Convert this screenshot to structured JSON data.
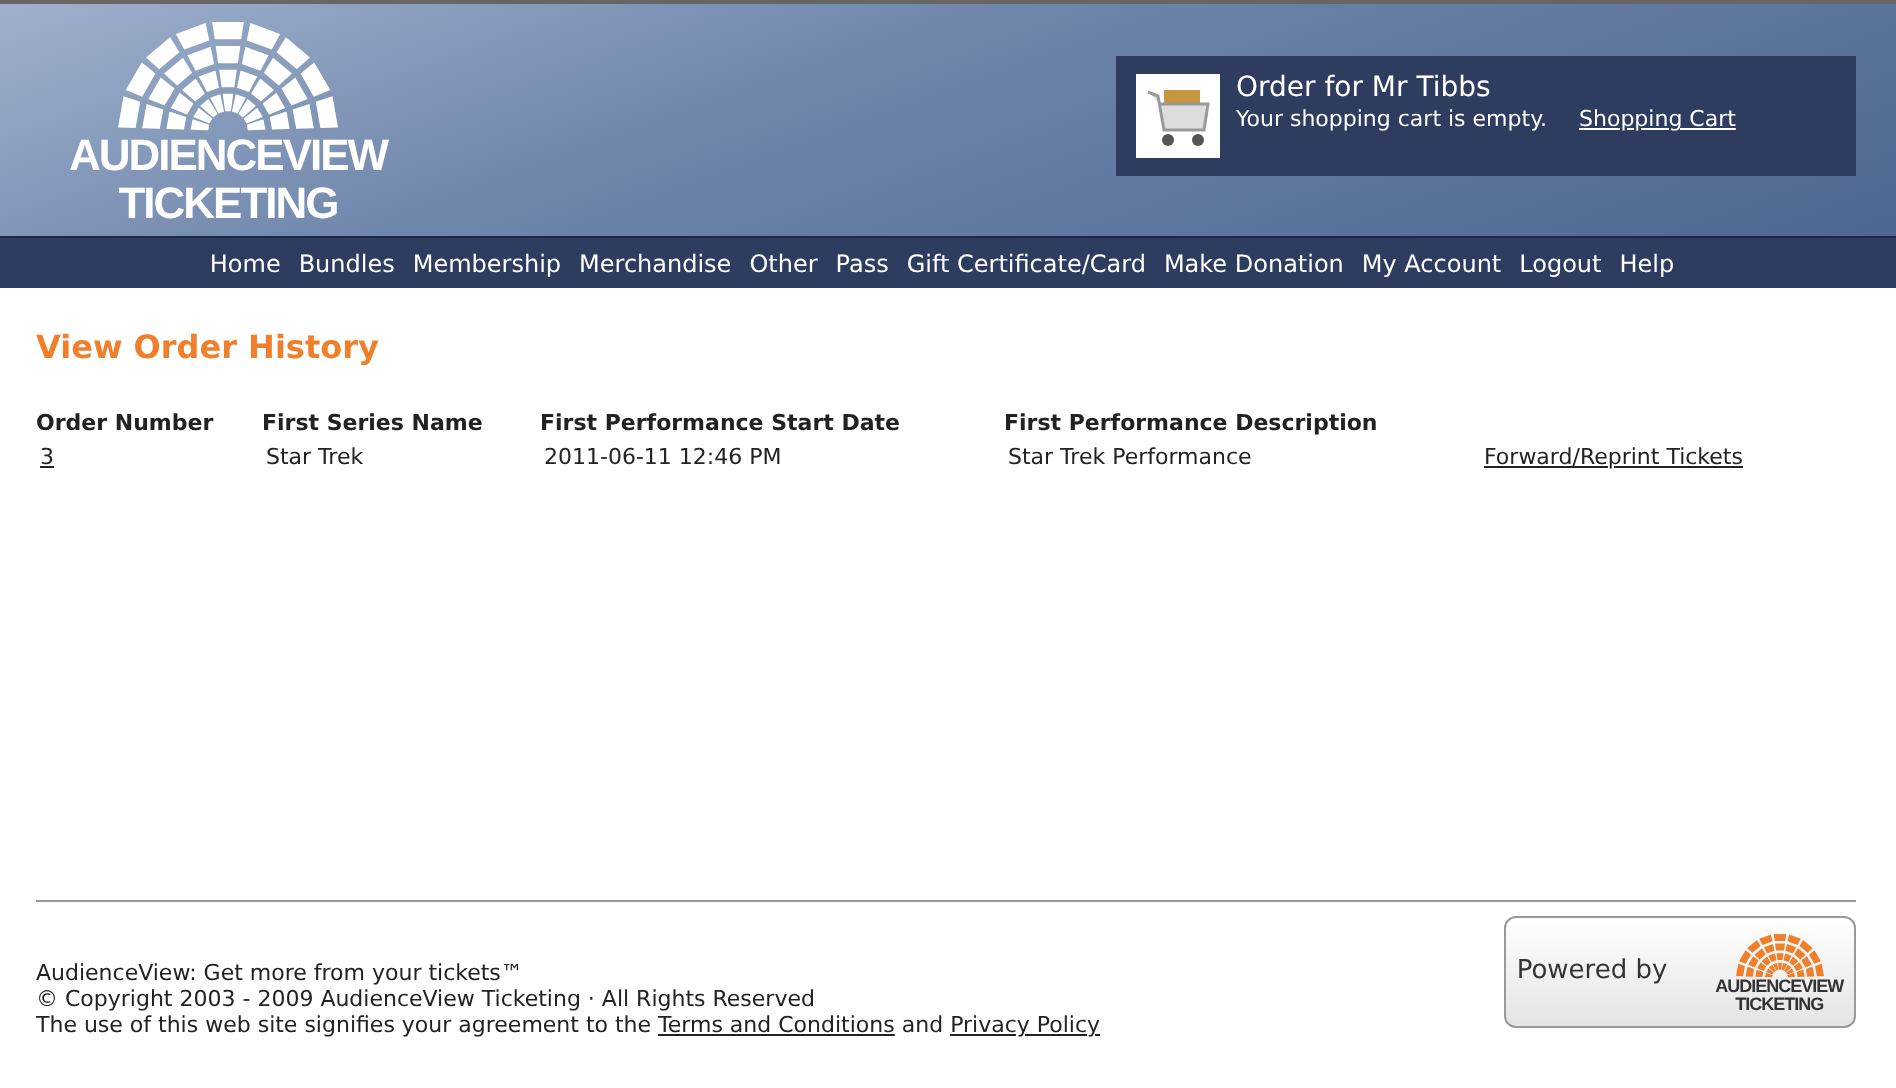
{
  "logo": {
    "line_1": "AUDIENCEVIEW",
    "line_2": "TICKETING"
  },
  "cart": {
    "title": "Order for Mr Tibbs",
    "status": "Your shopping cart is empty.",
    "link": "Shopping Cart"
  },
  "nav": [
    "Home",
    "Bundles",
    "Membership",
    "Merchandise",
    "Other",
    "Pass",
    "Gift Certificate/Card",
    "Make Donation",
    "My Account",
    "Logout",
    "Help"
  ],
  "page_title": "View Order History",
  "table": {
    "columns": [
      "Order Number",
      "First Series Name",
      "First Performance Start Date",
      "First Performance Description"
    ],
    "rows": [
      {
        "order_number": "3",
        "series": "Star Trek",
        "start_date": "2011-06-11 12:46 PM",
        "description": "Star Trek Performance",
        "action": "Forward/Reprint Tickets"
      }
    ]
  },
  "footer": {
    "tagline": "AudienceView: Get more from your tickets™",
    "copyright": "© Copyright 2003 - 2009 AudienceView Ticketing · All Rights Reserved",
    "agreement": "The use of this web site signifies your agreement to the",
    "terms": "Terms and Conditions",
    "and": "and",
    "privacy": "Privacy Policy"
  },
  "powered": {
    "label": "Powered by",
    "logo_line_1": "AUDIENCEVIEW",
    "logo_line_2": "TICKETING"
  }
}
